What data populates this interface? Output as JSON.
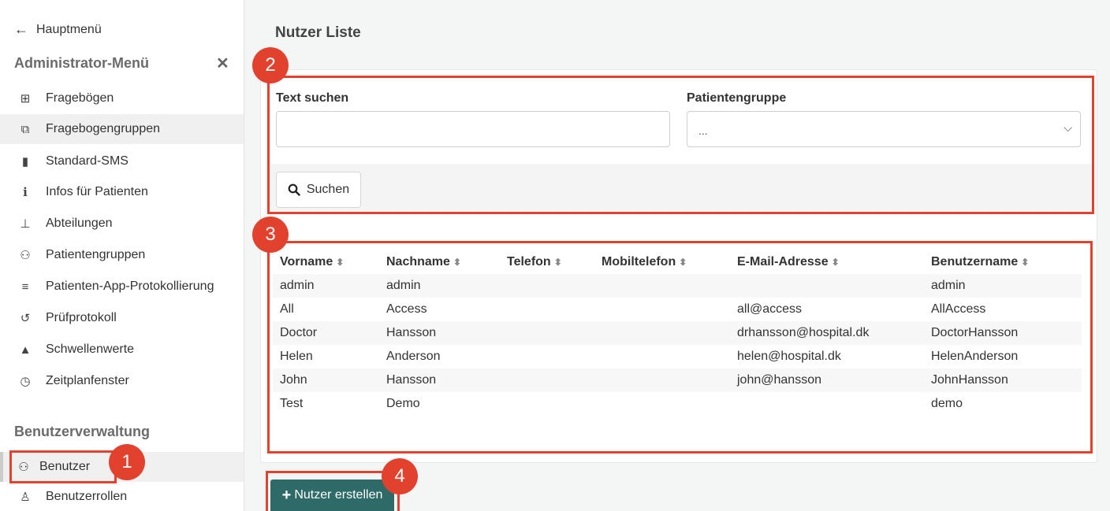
{
  "sidebar": {
    "back_label": "Hauptmenü",
    "admin_title": "Administrator-Menü",
    "items": [
      {
        "label": "Fragebögen",
        "icon": "file-plus-icon"
      },
      {
        "label": "Fragebogengruppen",
        "icon": "files-plus-icon"
      },
      {
        "label": "Standard-SMS",
        "icon": "phone-icon"
      },
      {
        "label": "Infos für Patienten",
        "icon": "info-icon"
      },
      {
        "label": "Abteilungen",
        "icon": "org-chart-icon"
      },
      {
        "label": "Patientengruppen",
        "icon": "group-settings-icon"
      },
      {
        "label": "Patienten-App-Protokollierung",
        "icon": "list-icon"
      },
      {
        "label": "Prüfprotokoll",
        "icon": "history-icon"
      },
      {
        "label": "Schwellenwerte",
        "icon": "threshold-icon"
      },
      {
        "label": "Zeitplanfenster",
        "icon": "clock-icon"
      }
    ],
    "section_title": "Benutzerverwaltung",
    "user_items": [
      {
        "label": "Benutzer",
        "icon": "users-icon"
      },
      {
        "label": "Benutzerrollen",
        "icon": "user-role-icon"
      }
    ]
  },
  "main": {
    "title": "Nutzer Liste",
    "search_label": "Text suchen",
    "search_value": "",
    "group_label": "Patientengruppe",
    "group_selected": "...",
    "search_button": "Suchen",
    "create_button": "Nutzer erstellen"
  },
  "table": {
    "headers": [
      "Vorname",
      "Nachname",
      "Telefon",
      "Mobiltelefon",
      "E-Mail-Adresse",
      "Benutzername"
    ],
    "rows": [
      [
        "admin",
        "admin",
        "",
        "",
        "",
        "admin"
      ],
      [
        "All",
        "Access",
        "",
        "",
        "all@access",
        "AllAccess"
      ],
      [
        "Doctor",
        "Hansson",
        "",
        "",
        "drhansson@hospital.dk",
        "DoctorHansson"
      ],
      [
        "Helen",
        "Anderson",
        "",
        "",
        "helen@hospital.dk",
        "HelenAnderson"
      ],
      [
        "John",
        "Hansson",
        "",
        "",
        "john@hansson",
        "JohnHansson"
      ],
      [
        "Test",
        "Demo",
        "",
        "",
        "",
        "demo"
      ]
    ]
  },
  "annotations": [
    "1",
    "2",
    "3",
    "4"
  ],
  "colors": {
    "accent": "#2e6b68",
    "annotation": "#e2412e"
  }
}
